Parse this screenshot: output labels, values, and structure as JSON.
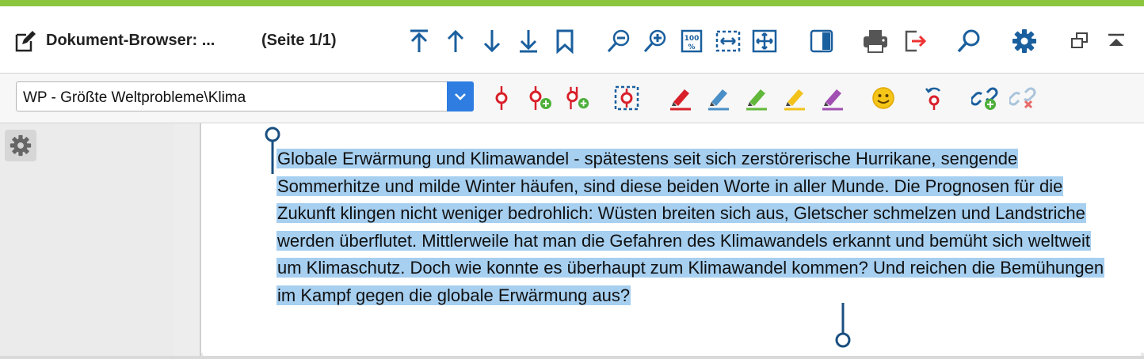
{
  "window": {
    "title": "Dokument-Browser: ...",
    "page_info": "(Seite 1/1)",
    "accent_color": "#8cc63f"
  },
  "top_toolbar": {
    "icons": [
      "jump-to-top-icon",
      "arrow-up-icon",
      "arrow-down-icon",
      "jump-to-bottom-icon",
      "bookmark-icon",
      "zoom-out-icon",
      "zoom-in-icon",
      "zoom-100-icon",
      "fit-width-icon",
      "fit-page-icon",
      "panel-toggle-icon",
      "printer-icon",
      "export-icon",
      "search-icon",
      "gear-icon",
      "undock-window-icon",
      "collapse-icon"
    ]
  },
  "code_toolbar": {
    "code_selector": "WP - Größte Weltprobleme\\Klima",
    "icons": [
      "code-pin-icon",
      "code-pin-add-icon",
      "code-pins-add-icon",
      "code-selection-icon",
      "highlighter-red-icon",
      "highlighter-blue-icon",
      "highlighter-green-icon",
      "highlighter-yellow-icon",
      "highlighter-purple-icon",
      "emoticon-icon",
      "undo-code-icon",
      "add-link-icon",
      "remove-link-icon"
    ]
  },
  "document": {
    "text": "Globale Erwärmung und Klimawandel - spätestens seit sich zerstörerische Hurrikane, sengende Sommerhitze und milde Winter häufen, sind diese beiden Worte in aller Munde. Die Prognosen für die Zukunft klingen nicht weniger bedrohlich: Wüsten breiten sich aus, Gletscher schmelzen und Landstriche werden überflutet. Mittlerweile hat man die Gefahren des Klimawandels erkannt und bemüht sich weltweit um Klimaschutz. Doch wie konnte es überhaupt zum Klimawandel kommen? Und reichen die Bemühungen im Kampf gegen die globale Erwärmung aus?",
    "highlight_color": "#a6cff0"
  }
}
